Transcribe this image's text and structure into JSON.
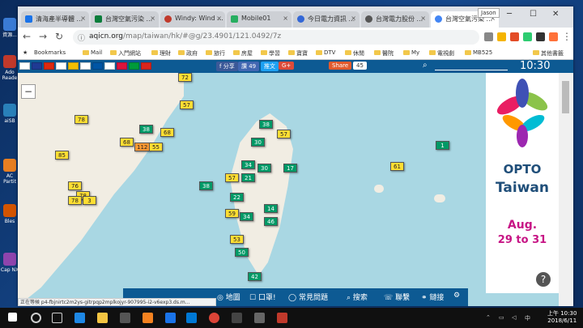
{
  "desktop": {
    "icons": [
      {
        "label": "資源..."
      },
      {
        "label": "Ado Reade"
      },
      {
        "label": "aiSB"
      },
      {
        "label": "AC Partit"
      },
      {
        "label": "Bles"
      },
      {
        "label": "Cap NX"
      }
    ]
  },
  "browser": {
    "profile": "Jason",
    "tabs": [
      {
        "label": "清海產半導體 ...",
        "color": "#1a73e8"
      },
      {
        "label": "台灣空氣污染 ...",
        "color": "#0a7d3b"
      },
      {
        "label": "Windy: Wind ...",
        "color": "#c0392b"
      },
      {
        "label": "Mobile01",
        "color": "#27ae60"
      },
      {
        "label": "今日電力資訊 ...",
        "color": "#3367d6"
      },
      {
        "label": "台灣電力股份 ...",
        "color": "#555555"
      },
      {
        "label": "台灣空氣污染 ...",
        "color": "#4285f4",
        "active": true
      }
    ],
    "url_host": "aqicn.org",
    "url_path": "/map/taiwan/hk/#@g/23.4901/121.0492/7z",
    "bookmarks": [
      "Bookmarks",
      "Mail",
      "入門網站",
      "理財",
      "政府",
      "旅行",
      "房屋",
      "學習",
      "寶寶",
      "DTV",
      "休閒",
      "醫院",
      "My",
      "電視劇",
      "MB525",
      "其他書籤"
    ]
  },
  "site": {
    "fb_share": "f 分享",
    "fb_like": "讚 49",
    "tweet": "推文",
    "gplus": "G+",
    "share": "Share",
    "share_count": "45",
    "clock": "10:30"
  },
  "map": {
    "zoom_out": "−",
    "markers": [
      {
        "v": "72",
        "c": "yellow"
      },
      {
        "v": "57",
        "c": "yellow"
      },
      {
        "v": "78",
        "c": "yellow"
      },
      {
        "v": "38",
        "c": "green"
      },
      {
        "v": "68",
        "c": "yellow"
      },
      {
        "v": "85",
        "c": "yellow"
      },
      {
        "v": "68",
        "c": "yellow"
      },
      {
        "v": "112",
        "c": "orange"
      },
      {
        "v": "55",
        "c": "yellow"
      },
      {
        "v": "76",
        "c": "yellow"
      },
      {
        "v": "78",
        "c": "yellow"
      },
      {
        "v": "3",
        "c": "yellow"
      },
      {
        "v": "78",
        "c": "yellow"
      },
      {
        "v": "38",
        "c": "green"
      },
      {
        "v": "57",
        "c": "yellow"
      },
      {
        "v": "30",
        "c": "green"
      },
      {
        "v": "17",
        "c": "green"
      },
      {
        "v": "38",
        "c": "green"
      },
      {
        "v": "34",
        "c": "green"
      },
      {
        "v": "30",
        "c": "green"
      },
      {
        "v": "21",
        "c": "green"
      },
      {
        "v": "57",
        "c": "yellow"
      },
      {
        "v": "22",
        "c": "green"
      },
      {
        "v": "14",
        "c": "green"
      },
      {
        "v": "59",
        "c": "yellow"
      },
      {
        "v": "34",
        "c": "green"
      },
      {
        "v": "46",
        "c": "green"
      },
      {
        "v": "53",
        "c": "yellow"
      },
      {
        "v": "50",
        "c": "green"
      },
      {
        "v": "42",
        "c": "green"
      },
      {
        "v": "61",
        "c": "yellow"
      },
      {
        "v": "1",
        "c": "green"
      }
    ]
  },
  "ad": {
    "line1": "OPTO",
    "line2": "Taiwan",
    "month": "Aug.",
    "days": "29 to 31",
    "help": "?"
  },
  "bottom_nav": [
    "地圖",
    "口罩!",
    "常見問題",
    "搜索",
    "聯繫",
    "鏈接"
  ],
  "status_bar": "正在等候 p4-fbjnirtc2m2ys-gitrpqp2mplkojyr-907995-i2-v6exp3.ds.m...",
  "taskbar": {
    "time": "上午 10:30",
    "date": "2018/6/11"
  }
}
